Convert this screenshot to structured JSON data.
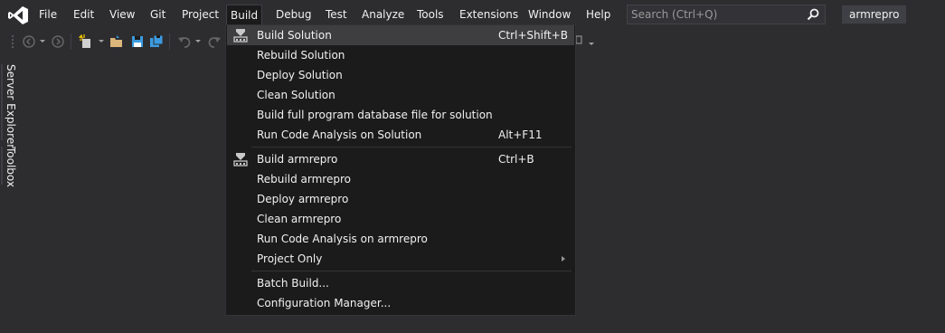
{
  "menubar": {
    "items": [
      "File",
      "Edit",
      "View",
      "Git",
      "Project",
      "Build",
      "Debug",
      "Test",
      "Analyze",
      "Tools",
      "Extensions",
      "Window",
      "Help"
    ],
    "active": "Build"
  },
  "search": {
    "placeholder": "Search (Ctrl+Q)"
  },
  "solution_name": "armrepro",
  "side_tabs": [
    "Server Explorer",
    "Toolbox"
  ],
  "build_menu": {
    "items": [
      {
        "label": "Build Solution",
        "shortcut": "Ctrl+Shift+B",
        "icon": "build-icon",
        "highlighted": true
      },
      {
        "label": "Rebuild Solution",
        "shortcut": ""
      },
      {
        "label": "Deploy Solution",
        "shortcut": ""
      },
      {
        "label": "Clean Solution",
        "shortcut": ""
      },
      {
        "label": "Build full program database file for solution",
        "shortcut": ""
      },
      {
        "label": "Run Code Analysis on Solution",
        "shortcut": "Alt+F11"
      },
      {
        "label": "Build armrepro",
        "shortcut": "Ctrl+B",
        "icon": "build-icon"
      },
      {
        "label": "Rebuild armrepro",
        "shortcut": ""
      },
      {
        "label": "Deploy armrepro",
        "shortcut": ""
      },
      {
        "label": "Clean armrepro",
        "shortcut": ""
      },
      {
        "label": "Run Code Analysis on armrepro",
        "shortcut": ""
      },
      {
        "label": "Project Only",
        "shortcut": "",
        "submenu": true
      },
      {
        "label": "Batch Build...",
        "shortcut": ""
      },
      {
        "label": "Configuration Manager...",
        "shortcut": ""
      }
    ]
  },
  "colors": {
    "background": "#2d2d30",
    "menu_background": "#1b1b1c",
    "hover": "#3e3e40",
    "accent": "#68217a"
  }
}
